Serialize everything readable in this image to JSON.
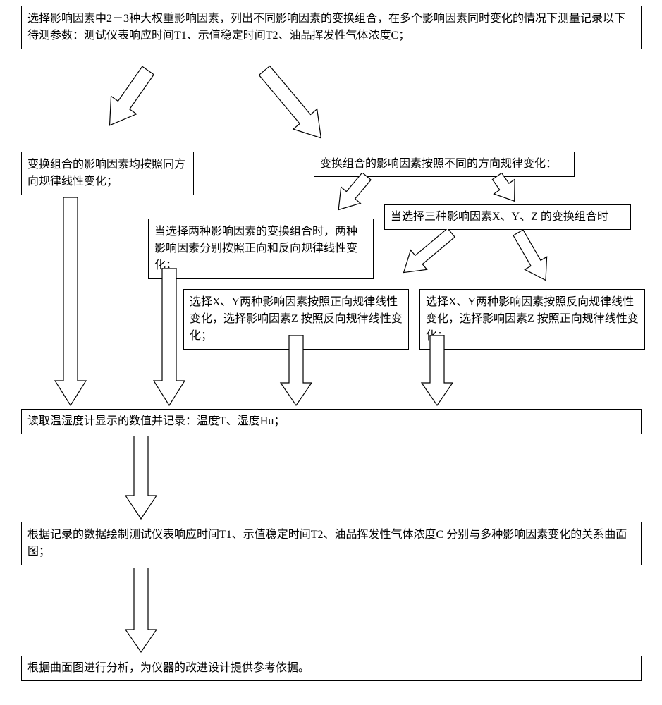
{
  "boxes": {
    "top": "选择影响因素中2－3种大权重影响因素，列出不同影响因素的变换组合，在多个影响因素同时变化的情况下测量记录以下待测参数：测试仪表响应时间T1、示值稳定时间T2、油品挥发性气体浓度C；",
    "left_same": "变换组合的影响因素均按照同方向规律线性变化；",
    "right_diff": "变换组合的影响因素按照不同的方向规律变化：",
    "two_factors": "当选择两种影响因素的变换组合时，两种影响因素分别按照正向和反向规律线性变化；",
    "three_factors": "当选择三种影响因素X、Y、Z 的变换组合时",
    "xy_pos_z_neg": "选择X、Y两种影响因素按照正向规律线性变化，选择影响因素Z 按照反向规律线性变化；",
    "xy_neg_z_pos": "选择X、Y两种影响因素按照反向规律线性变化，选择影响因素Z 按照正向规律线性变化；",
    "read_values": "读取温湿度计显示的数值并记录：温度T、湿度Hu；",
    "draw_curves": "根据记录的数据绘制测试仪表响应时间T1、示值稳定时间T2、油品挥发性气体浓度C 分别与多种影响因素变化的关系曲面图；",
    "analyze": "根据曲面图进行分析，为仪器的改进设计提供参考依据。"
  }
}
